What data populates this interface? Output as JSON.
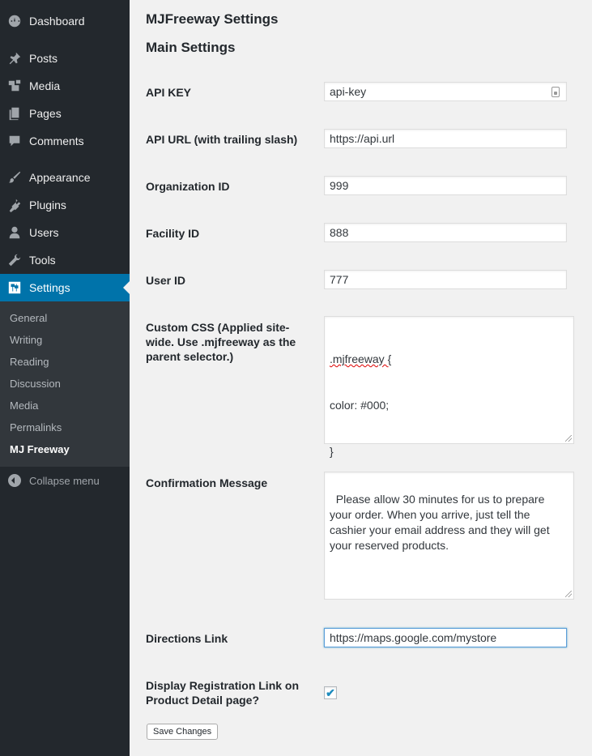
{
  "sidebar": {
    "items": [
      {
        "label": "Dashboard",
        "icon": "dashboard-icon"
      },
      {
        "label": "Posts",
        "icon": "pin-icon"
      },
      {
        "label": "Media",
        "icon": "media-icon"
      },
      {
        "label": "Pages",
        "icon": "pages-icon"
      },
      {
        "label": "Comments",
        "icon": "comments-icon"
      },
      {
        "label": "Appearance",
        "icon": "paintbrush-icon"
      },
      {
        "label": "Plugins",
        "icon": "plugins-icon"
      },
      {
        "label": "Users",
        "icon": "users-icon"
      },
      {
        "label": "Tools",
        "icon": "wrench-icon"
      },
      {
        "label": "Settings",
        "icon": "settings-icon",
        "active": true
      }
    ],
    "submenu": [
      "General",
      "Writing",
      "Reading",
      "Discussion",
      "Media",
      "Permalinks",
      "MJ Freeway"
    ],
    "submenu_current": "MJ Freeway",
    "collapse_label": "Collapse menu"
  },
  "page": {
    "title": "MJFreeway Settings",
    "section": "Main Settings"
  },
  "fields": {
    "api_key": {
      "label": "API KEY",
      "value": "api-key"
    },
    "api_url": {
      "label": "API URL (with trailing slash)",
      "value": "https://api.url"
    },
    "org_id": {
      "label": "Organization ID",
      "value": "999"
    },
    "facility_id": {
      "label": "Facility ID",
      "value": "888"
    },
    "user_id": {
      "label": "User ID",
      "value": "777"
    },
    "custom_css": {
      "label": "Custom CSS (Applied site-wide. Use .mjfreeway as the parent selector.)",
      "line1": ".mjfreeway {",
      "line2": "color: #000;",
      "line3": "}"
    },
    "confirmation": {
      "label": "Confirmation Message",
      "value": "Please allow 30 minutes for us to prepare your order. When you arrive, just tell the cashier your email address and they will get your reserved products."
    },
    "directions": {
      "label": "Directions Link",
      "value": "https://maps.google.com/mystore"
    },
    "registration": {
      "label": "Display Registration Link on Product Detail page?",
      "checked": true,
      "check_glyph": "✔"
    }
  },
  "save_label": "Save Changes",
  "colors": {
    "sidebar_bg": "#23282d",
    "active": "#0073aa",
    "submenu_bg": "#32373c"
  }
}
